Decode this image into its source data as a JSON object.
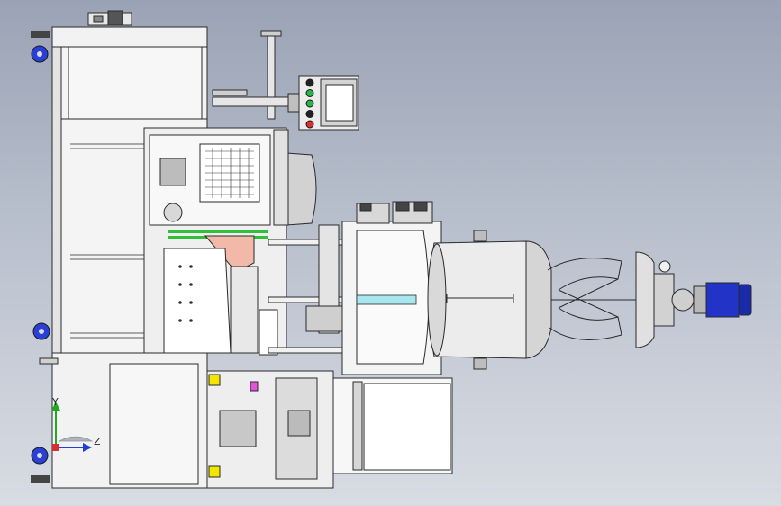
{
  "viewport": {
    "background_top": "#9aa3b5",
    "background_bottom": "#d8dce3"
  },
  "colors": {
    "frame_fill": "#f2f2f2",
    "frame_stroke": "#2a2a2a",
    "steel": "#d9dadc",
    "dark_steel": "#6b6f75",
    "motor_blue": "#2233c8",
    "caster_blue": "#2a3fd6",
    "accent_yellow": "#f2e600",
    "accent_green": "#2fbf3a",
    "accent_cyan": "#a8e7f0",
    "accent_salmon": "#f2b8a8",
    "accent_magenta": "#e055d9",
    "screen_fill": "#ffffff",
    "light_red": "#d83030",
    "light_green": "#25b54a",
    "light_black": "#222222",
    "axis_y_color": "#22a822",
    "axis_z_color": "#1f3fd8"
  },
  "triad": {
    "y_label": "Y",
    "z_label": "Z"
  },
  "control_panel": {
    "indicator_colors": [
      "#222222",
      "#25b54a",
      "#25b54a",
      "#222222",
      "#d83030"
    ]
  }
}
